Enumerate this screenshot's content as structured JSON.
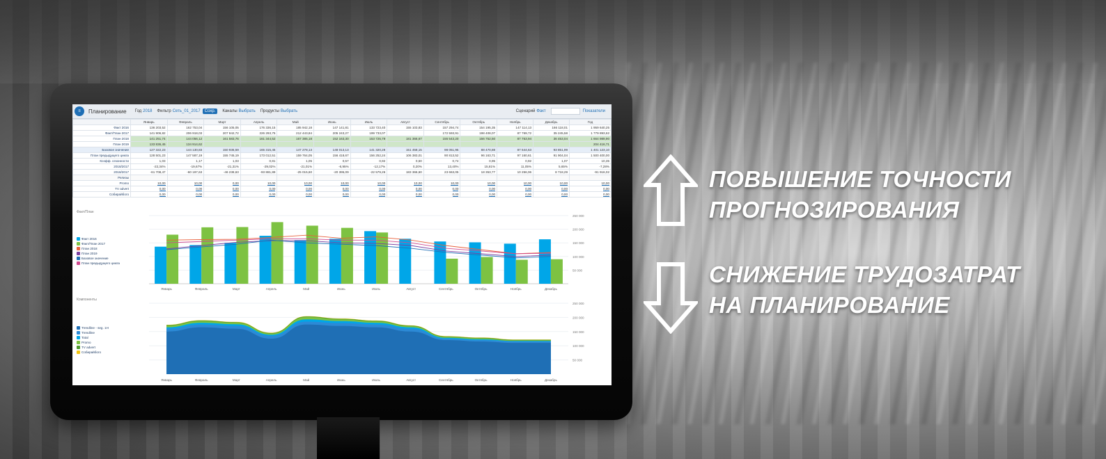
{
  "app": {
    "title": "Планирование",
    "filters": [
      {
        "label": "Год",
        "value": "2018"
      },
      {
        "label": "Фильтр",
        "value": "Сеть_01_2017"
      },
      {
        "label": "Каналы",
        "value": "Выбрать"
      },
      {
        "label": "Продукты",
        "value": "Выбрать"
      }
    ],
    "apply_label": "Сохр.",
    "right_label_1": "Сценарий",
    "right_label_2": "Факт",
    "right_label_3": "Показатели"
  },
  "table": {
    "months": [
      "Январь",
      "Февраль",
      "Март",
      "Апрель",
      "Май",
      "Июнь",
      "Июль",
      "Август",
      "Сентябрь",
      "Октябрь",
      "Ноябрь",
      "Декабрь",
      "Год"
    ],
    "rows": [
      {
        "label": "Факт 2016",
        "style": "",
        "values": [
          "136 203,52",
          "162 753,04",
          "156 105,05",
          "176 336,15",
          "185 942,18",
          "147 141,81",
          "133 723,40",
          "155 103,83",
          "157 294,74",
          "154 195,35",
          "147 114,13",
          "166 118,01",
          "1 959 640,25"
        ]
      },
      {
        "label": "Факт/План 2017",
        "style": "",
        "values": [
          "141 906,82",
          "206 918,03",
          "207 842,72",
          "226 293,75",
          "212 443,84",
          "205 243,27",
          "199 733,07",
          "",
          "172 593,91",
          "198 408,07",
          "87 769,72",
          "35 245,58",
          "1 779 893,62"
        ]
      },
      {
        "label": "План 2018",
        "style": "green",
        "values": [
          "141 251,74",
          "144 056,12",
          "161 583,76",
          "161 344,52",
          "167 385,18",
          "152 163,30",
          "153 725,79",
          "181 366,67",
          "155 543,20",
          "156 752,50",
          "87 763,94",
          "36 453,04",
          "1 664 989,90"
        ]
      },
      {
        "label": "План 2019",
        "style": "green",
        "values": [
          "133 836,45",
          "134 914,62",
          "",
          "",
          "",
          "",
          "",
          "",
          "",
          "",
          "",
          "",
          "204 416,71"
        ]
      },
      {
        "label": "Базовое значение",
        "style": "hl",
        "values": [
          "127 322,23",
          "144 130,83",
          "150 936,59",
          "165 315,45",
          "147 278,13",
          "148 013,13",
          "141 320,28",
          "151 458,15",
          "98 051,95",
          "88 470,88",
          "87 644,63",
          "93 851,99",
          "1 401 123,10"
        ]
      },
      {
        "label": "План предыдущего цикла",
        "style": "",
        "values": [
          "128 501,23",
          "147 587,19",
          "155 745,19",
          "173 012,51",
          "159 764,05",
          "156 418,67",
          "156 252,24",
          "106 383,01",
          "90 813,52",
          "96 163,71",
          "97 160,61",
          "91 904,04",
          "1 500 400,00"
        ]
      },
      {
        "label": "Коэфф. сезонности",
        "style": "",
        "values": [
          "1,03",
          "1,17",
          "1,03",
          "0,81",
          "1,05",
          "0,57",
          "0,92",
          "0,50",
          "0,74",
          "0,95",
          "0,92",
          "1,07",
          "10,35"
        ]
      },
      {
        "label": "2018/2017",
        "style": "",
        "values": [
          "-22,34%",
          "-19,67%",
          "-21,31%",
          "-29,02%",
          "-21,01%",
          "-6,95%",
          "-12,17%",
          "0,20%",
          "13,40%",
          "15,81%",
          "11,05%",
          "5,65%",
          "-7,28%"
        ]
      },
      {
        "label": "2018/2017",
        "style": "",
        "values": [
          "-61 708,47",
          "-60 197,63",
          "-46 238,63",
          "-93 881,89",
          "-25 015,60",
          "-20 395,09",
          "-22 579,26",
          "183 366,60",
          "23 663,05",
          "18 353,77",
          "10 256,06",
          "8 718,29",
          "-91 916,02"
        ]
      },
      {
        "label": "Релизы",
        "style": "sep",
        "values": [
          "",
          "",
          "",
          "",
          "",
          "",
          "",
          "",
          "",
          "",
          "",
          "",
          ""
        ]
      },
      {
        "label": "Promo",
        "style": "edit",
        "values": [
          "10,00",
          "10,00",
          "0,00",
          "10,00",
          "10,00",
          "10,00",
          "10,00",
          "10,00",
          "10,00",
          "10,00",
          "10,00",
          "10,00",
          "10,00"
        ]
      },
      {
        "label": "TV advert",
        "style": "edit",
        "values": [
          "0,00",
          "0,00",
          "0,00",
          "0,00",
          "0,00",
          "0,00",
          "0,00",
          "0,00",
          "0,00",
          "0,00",
          "0,00",
          "0,00",
          "0,00"
        ]
      },
      {
        "label": "Собирайбого",
        "style": "edit",
        "values": [
          "0,00",
          "0,00",
          "0,00",
          "0,00",
          "0,00",
          "0,00",
          "0,00",
          "0,00",
          "0,00",
          "0,00",
          "0,00",
          "0,00",
          "0,00"
        ]
      }
    ]
  },
  "chart_data": [
    {
      "type": "bar",
      "title": "Факт/План",
      "categories": [
        "Январь",
        "Февраль",
        "Март",
        "Апрель",
        "Май",
        "Июнь",
        "Июль",
        "Август",
        "Сентябрь",
        "Октябрь",
        "Ноябрь",
        "Декабрь"
      ],
      "series": [
        {
          "name": "Факт 2016",
          "kind": "bar",
          "color": "#00a6e8",
          "values": [
            136,
            142,
            150,
            176,
            160,
            165,
            193,
            165,
            155,
            152,
            147,
            163
          ]
        },
        {
          "name": "Факт/План 2017",
          "kind": "bar",
          "color": "#7dc242",
          "values": [
            180,
            207,
            208,
            226,
            213,
            205,
            188,
            null,
            92,
            98,
            88,
            90
          ]
        },
        {
          "name": "План 2018",
          "kind": "line",
          "color": "#e8603c",
          "values": [
            160,
            162,
            163,
            170,
            178,
            167,
            172,
            160,
            140,
            125,
            110,
            115
          ]
        },
        {
          "name": "План 2019",
          "kind": "line",
          "color": "#7a3fa0",
          "values": [
            128,
            140,
            152,
            158,
            158,
            150,
            148,
            140,
            120,
            110,
            100,
            105
          ]
        },
        {
          "name": "Базовое значение",
          "kind": "line",
          "color": "#1f6fb5",
          "values": [
            125,
            135,
            145,
            160,
            150,
            145,
            140,
            130,
            115,
            105,
            95,
            100
          ]
        },
        {
          "name": "План предыдущего цикла",
          "kind": "line",
          "color": "#d04a8f",
          "values": [
            150,
            155,
            160,
            165,
            165,
            160,
            160,
            150,
            130,
            120,
            110,
            112
          ]
        }
      ],
      "ylim": [
        0,
        250
      ],
      "y_ticks": [
        "250 000",
        "200 000",
        "150 000",
        "100 000",
        "50 000"
      ],
      "legend": "left"
    },
    {
      "type": "area",
      "title": "Компоненты",
      "categories": [
        "Январь",
        "Февраль",
        "Март",
        "Апрель",
        "Май",
        "Июнь",
        "Июль",
        "Август",
        "Сентябрь",
        "Октябрь",
        "Ноябрь",
        "Декабрь"
      ],
      "series": [
        {
          "name": "Trendline - seg. 1Н",
          "color": "#1f6fb5",
          "values": [
            150,
            165,
            160,
            125,
            175,
            170,
            165,
            150,
            120,
            115,
            110,
            110
          ]
        },
        {
          "name": "Trendline",
          "color": "#2c8ad6",
          "values": [
            10,
            10,
            10,
            10,
            10,
            10,
            10,
            10,
            5,
            5,
            5,
            5
          ]
        },
        {
          "name": "Total",
          "color": "#00a6e8",
          "values": [
            5,
            6,
            6,
            4,
            8,
            7,
            6,
            5,
            3,
            3,
            2,
            2
          ]
        },
        {
          "name": "Promo",
          "color": "#7dc242",
          "values": [
            6,
            6,
            5,
            4,
            8,
            6,
            5,
            4,
            3,
            3,
            2,
            2
          ]
        },
        {
          "name": "TV advert",
          "color": "#4f9a2e",
          "values": [
            2,
            2,
            2,
            2,
            2,
            2,
            2,
            2,
            2,
            2,
            2,
            2
          ]
        },
        {
          "name": "Собирайбого",
          "color": "#f1c40f",
          "values": [
            1,
            1,
            1,
            1,
            1,
            1,
            1,
            1,
            1,
            1,
            1,
            1
          ]
        }
      ],
      "ylim": [
        0,
        250
      ],
      "y_ticks": [
        "250 000",
        "200 000",
        "150 000",
        "100 000",
        "50 000"
      ],
      "legend": "left"
    }
  ],
  "headlines": {
    "up_line1": "ПОВЫШЕНИЕ ТОЧНОСТИ",
    "up_line2": "ПРОГНОЗИРОВАНИЯ",
    "down_line1": "СНИЖЕНИЕ ТРУДОЗАТРАТ",
    "down_line2": "НА ПЛАНИРОВАНИЕ"
  }
}
